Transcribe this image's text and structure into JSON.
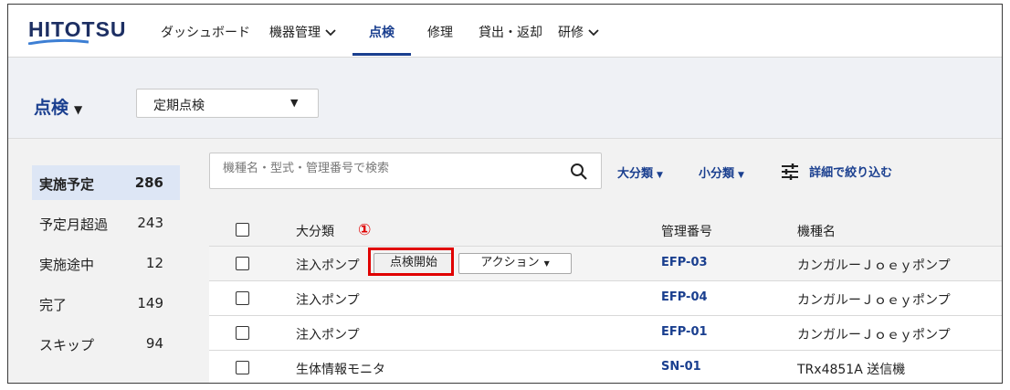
{
  "nav": {
    "logo": "HITOTSU",
    "items": [
      {
        "label": "ダッシュボード",
        "dropdown": false,
        "active": false
      },
      {
        "label": "機器管理",
        "dropdown": true,
        "active": false
      },
      {
        "label": "点検",
        "dropdown": false,
        "active": true
      },
      {
        "label": "修理",
        "dropdown": false,
        "active": false
      },
      {
        "label": "貸出・返却",
        "dropdown": false,
        "active": false
      },
      {
        "label": "研修",
        "dropdown": true,
        "active": false
      }
    ],
    "caret_down": "⌄"
  },
  "header": {
    "title": "点検",
    "title_caret": "▼",
    "select_value": "定期点検",
    "select_caret": "▼"
  },
  "status_list": [
    {
      "label": "実施予定",
      "count": "286",
      "active": true
    },
    {
      "label": "予定月超過",
      "count": "243",
      "active": false
    },
    {
      "label": "実施途中",
      "count": "12",
      "active": false
    },
    {
      "label": "完了",
      "count": "149",
      "active": false
    },
    {
      "label": "スキップ",
      "count": "94",
      "active": false
    }
  ],
  "search": {
    "placeholder": "機種名・型式・管理番号で検索"
  },
  "filters": {
    "major": "大分類",
    "minor": "小分類",
    "caret": "▼",
    "detail": "詳細で絞り込む"
  },
  "table": {
    "headers": {
      "category": "大分類",
      "id": "管理番号",
      "model": "機種名"
    },
    "rows": [
      {
        "category": "注入ポンプ",
        "id": "EFP-03",
        "model": "カンガルーＪｏｅｙポンプ"
      },
      {
        "category": "注入ポンプ",
        "id": "EFP-04",
        "model": "カンガルーＪｏｅｙポンプ"
      },
      {
        "category": "注入ポンプ",
        "id": "EFP-01",
        "model": "カンガルーＪｏｅｙポンプ"
      },
      {
        "category": "生体情報モニタ",
        "id": "SN-01",
        "model": "TRx4851A 送信機"
      }
    ],
    "inspect_button": "点検開始",
    "action_button": "アクション",
    "action_caret": "▼"
  },
  "annotation": {
    "marker": "①"
  },
  "colors": {
    "brand": "#1a3f8f",
    "highlight": "#e00000",
    "active_status_bg": "#dde6f5"
  }
}
